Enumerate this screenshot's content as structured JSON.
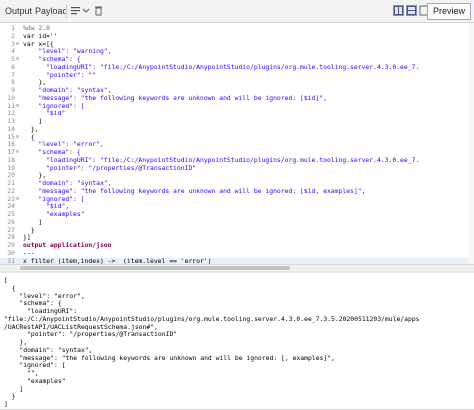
{
  "toolbar": {
    "tab_output": "Output",
    "tab_payload": "Payload",
    "preview_label": "Preview"
  },
  "colors": {
    "keyword": "#7f0055",
    "string": "#2a00ff",
    "comment": "#3f7f5f",
    "line_number": "#8a8a8a",
    "highlight": "#e8f0fb"
  },
  "editor": {
    "lines": [
      {
        "n": "1",
        "fold": "",
        "segments": [
          {
            "t": "%dw 2.0",
            "c": "comment"
          }
        ]
      },
      {
        "n": "2",
        "fold": "",
        "segments": [
          {
            "t": "var id=''",
            "c": "plain"
          }
        ]
      },
      {
        "n": "3",
        "fold": "⊖",
        "segments": [
          {
            "t": "var x=[{",
            "c": "plain"
          }
        ]
      },
      {
        "n": "4",
        "fold": "",
        "segments": [
          {
            "t": "    \"level\": \"warning\",",
            "c": "string"
          }
        ]
      },
      {
        "n": "5",
        "fold": "⊖",
        "segments": [
          {
            "t": "    \"schema\": {",
            "c": "string"
          }
        ]
      },
      {
        "n": "6",
        "fold": "",
        "segments": [
          {
            "t": "      \"loadingURI\": \"file:/C:/AnypointStudio/AnypointStudio/plugins/org.mule.tooling.server.4.3.0.ee_7.",
            "c": "string"
          }
        ]
      },
      {
        "n": "7",
        "fold": "",
        "segments": [
          {
            "t": "      \"pointer\": \"\"",
            "c": "string"
          }
        ]
      },
      {
        "n": "8",
        "fold": "",
        "segments": [
          {
            "t": "    },",
            "c": "plain"
          }
        ]
      },
      {
        "n": "9",
        "fold": "",
        "segments": [
          {
            "t": "    \"domain\": \"syntax\",",
            "c": "string"
          }
        ]
      },
      {
        "n": "10",
        "fold": "",
        "segments": [
          {
            "t": "    \"message\": \"the following keywords are unknown and will be ignored: [$id]\",",
            "c": "string"
          }
        ]
      },
      {
        "n": "11",
        "fold": "⊖",
        "segments": [
          {
            "t": "    \"ignored\": [",
            "c": "string"
          }
        ]
      },
      {
        "n": "12",
        "fold": "",
        "segments": [
          {
            "t": "      \"$id\"",
            "c": "string"
          }
        ]
      },
      {
        "n": "13",
        "fold": "",
        "segments": [
          {
            "t": "    ]",
            "c": "plain"
          }
        ]
      },
      {
        "n": "14",
        "fold": "",
        "segments": [
          {
            "t": "  },",
            "c": "plain"
          }
        ]
      },
      {
        "n": "15",
        "fold": "⊖",
        "segments": [
          {
            "t": "  {",
            "c": "plain"
          }
        ]
      },
      {
        "n": "16",
        "fold": "",
        "segments": [
          {
            "t": "    \"level\": \"error\",",
            "c": "string"
          }
        ]
      },
      {
        "n": "17",
        "fold": "⊖",
        "segments": [
          {
            "t": "    \"schema\": {",
            "c": "string"
          }
        ]
      },
      {
        "n": "18",
        "fold": "",
        "segments": [
          {
            "t": "      \"loadingURI\": \"file:/C:/AnypointStudio/AnypointStudio/plugins/org.mule.tooling.server.4.3.0.ee_7.",
            "c": "string"
          }
        ]
      },
      {
        "n": "19",
        "fold": "",
        "segments": [
          {
            "t": "      \"pointer\": \"/properties/@TransactionID\"",
            "c": "string"
          }
        ]
      },
      {
        "n": "20",
        "fold": "",
        "segments": [
          {
            "t": "    },",
            "c": "plain"
          }
        ]
      },
      {
        "n": "21",
        "fold": "",
        "segments": [
          {
            "t": "    \"domain\": \"syntax\",",
            "c": "string"
          }
        ]
      },
      {
        "n": "22",
        "fold": "",
        "segments": [
          {
            "t": "    \"message\": \"the following keywords are unknown and will be ignored: [$id, examples]\",",
            "c": "string"
          }
        ]
      },
      {
        "n": "23",
        "fold": "⊖",
        "segments": [
          {
            "t": "    \"ignored\": [",
            "c": "string"
          }
        ]
      },
      {
        "n": "24",
        "fold": "",
        "segments": [
          {
            "t": "      \"$id\",",
            "c": "string"
          }
        ]
      },
      {
        "n": "25",
        "fold": "",
        "segments": [
          {
            "t": "      \"examples\"",
            "c": "string"
          }
        ]
      },
      {
        "n": "26",
        "fold": "",
        "segments": [
          {
            "t": "    ]",
            "c": "plain"
          }
        ]
      },
      {
        "n": "27",
        "fold": "",
        "segments": [
          {
            "t": "  }",
            "c": "plain"
          }
        ]
      },
      {
        "n": "28",
        "fold": "",
        "segments": [
          {
            "t": "}]",
            "c": "plain"
          }
        ]
      },
      {
        "n": "29",
        "fold": "",
        "segments": [
          {
            "t": "output application/json",
            "c": "keyword"
          }
        ]
      },
      {
        "n": "30",
        "fold": "",
        "segments": [
          {
            "t": "---",
            "c": "plain"
          }
        ]
      },
      {
        "n": "31",
        "fold": "",
        "segments": [
          {
            "t": "x filter (item,index) ->  (item.level == 'error')",
            "c": "plain"
          }
        ],
        "highlight": true
      }
    ]
  },
  "output": {
    "lines": [
      "[",
      "  {",
      "    \"level\": \"error\",",
      "    \"schema\": {",
      "      \"loadingURI\":",
      "\"file:/C:/AnypointStudio/AnypointStudio/plugins/org.mule.tooling.server.4.3.0.ee_7.3.5.20200511203/mule/apps",
      "/UACRestAPI/UACListRequestSchema.json#\",",
      "      \"pointer\": \"/properties/@TransactionID\"",
      "    },",
      "    \"domain\": \"syntax\",",
      "    \"message\": \"the following keywords are unknown and will be ignored: [, examples]\",",
      "    \"ignored\": [",
      "      \"\",",
      "      \"examples\"",
      "    ]",
      "  }",
      "]"
    ]
  }
}
